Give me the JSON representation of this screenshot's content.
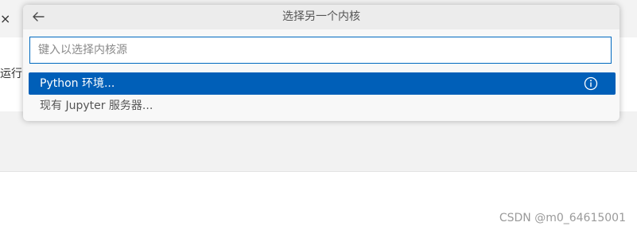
{
  "background": {
    "toolbar_label": "运行",
    "tab_close_glyph": "×"
  },
  "quick_pick": {
    "title": "选择另一个内核",
    "input_placeholder": "键入以选择内核源",
    "items": [
      {
        "label": "Python 环境...",
        "selected": true,
        "icon": "info-icon"
      },
      {
        "label": "现有 Jupyter 服务器...",
        "selected": false
      }
    ]
  },
  "watermark": "CSDN @m0_64615001",
  "colors": {
    "accent": "#005fb8",
    "input_border": "#0069c0"
  }
}
